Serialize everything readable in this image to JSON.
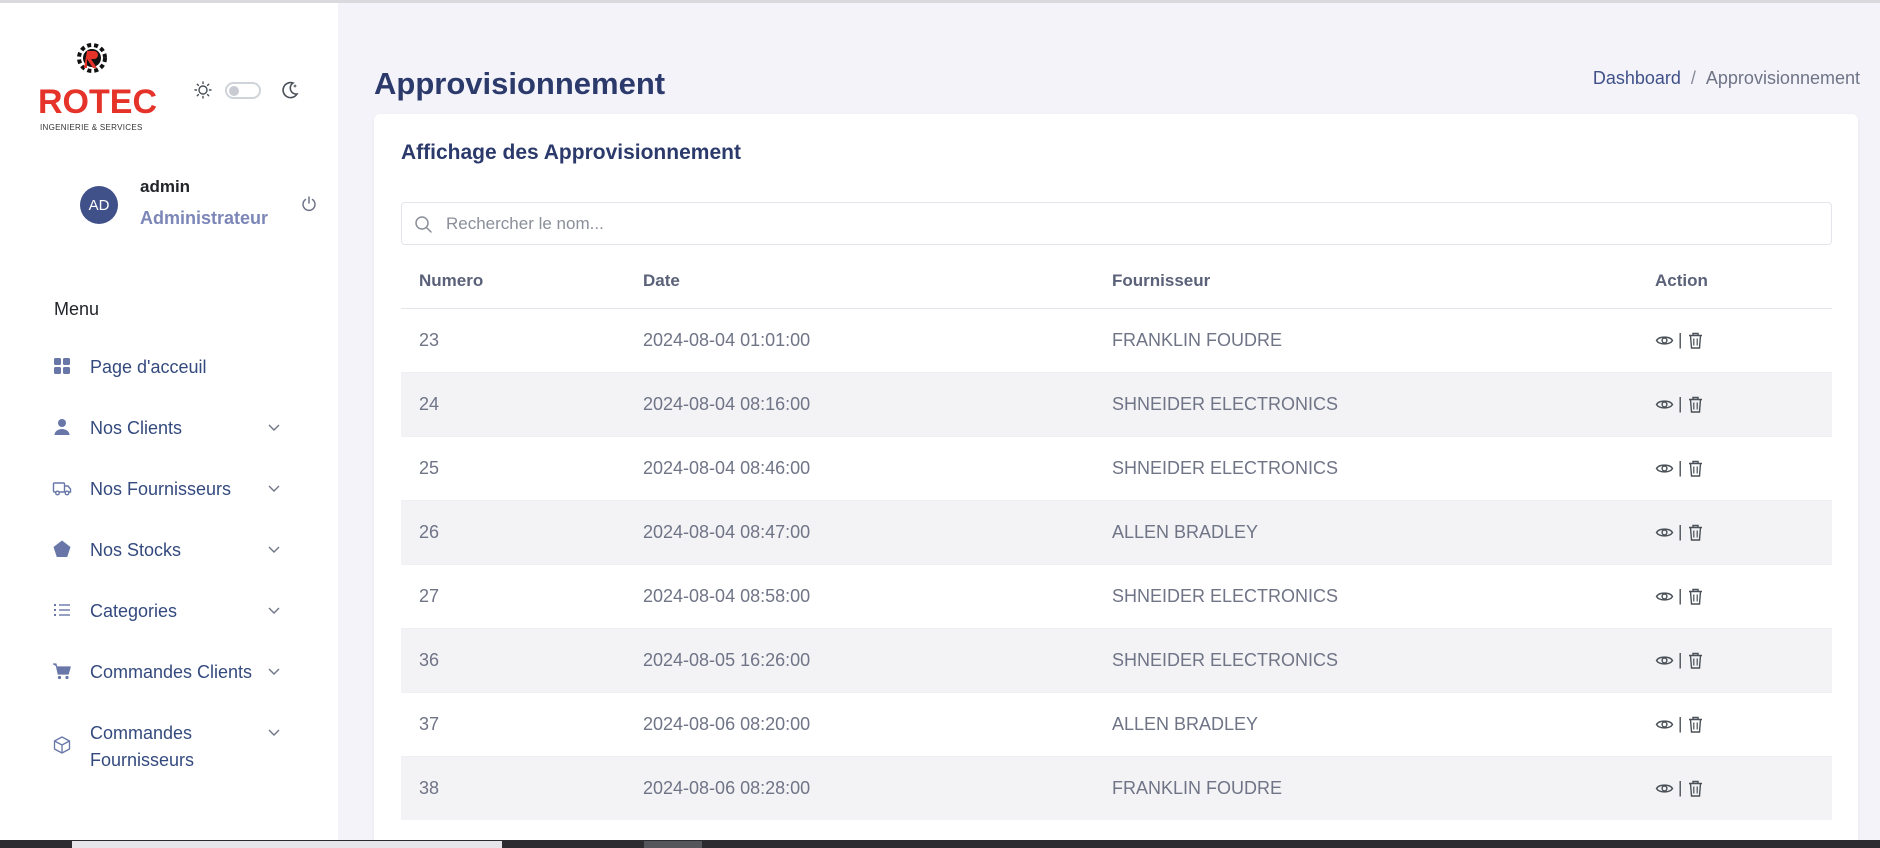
{
  "brand": {
    "name": "ROTEC",
    "tagline": "INGENIERIE & SERVICES"
  },
  "user": {
    "initials": "AD",
    "name": "admin",
    "role": "Administrateur"
  },
  "sidebar": {
    "menu_title": "Menu",
    "items": [
      {
        "label": "Page d'acceuil",
        "icon": "dashboard-grid-icon",
        "has_chevron": false
      },
      {
        "label": "Nos Clients",
        "icon": "user-icon",
        "has_chevron": true
      },
      {
        "label": "Nos Fournisseurs",
        "icon": "truck-icon",
        "has_chevron": true
      },
      {
        "label": "Nos Stocks",
        "icon": "pentagon-icon",
        "has_chevron": true
      },
      {
        "label": "Categories",
        "icon": "list-icon",
        "has_chevron": true
      },
      {
        "label": "Commandes Clients",
        "icon": "cart-icon",
        "has_chevron": true
      },
      {
        "label": "Commandes Fournisseurs",
        "icon": "box-icon",
        "has_chevron": true
      }
    ]
  },
  "header": {
    "title": "Approvisionnement",
    "breadcrumb": {
      "link": "Dashboard",
      "separator": "/",
      "current": "Approvisionnement"
    }
  },
  "card": {
    "title": "Affichage des Approvisionnement",
    "search_placeholder": "Rechercher le nom...",
    "search_value": ""
  },
  "table": {
    "columns": [
      "Numero",
      "Date",
      "Fournisseur",
      "Action"
    ],
    "rows": [
      {
        "numero": "23",
        "date": "2024-08-04 01:01:00",
        "fournisseur": "FRANKLIN FOUDRE"
      },
      {
        "numero": "24",
        "date": "2024-08-04 08:16:00",
        "fournisseur": "SHNEIDER ELECTRONICS"
      },
      {
        "numero": "25",
        "date": "2024-08-04 08:46:00",
        "fournisseur": "SHNEIDER ELECTRONICS"
      },
      {
        "numero": "26",
        "date": "2024-08-04 08:47:00",
        "fournisseur": "ALLEN BRADLEY"
      },
      {
        "numero": "27",
        "date": "2024-08-04 08:58:00",
        "fournisseur": "SHNEIDER ELECTRONICS"
      },
      {
        "numero": "36",
        "date": "2024-08-05 16:26:00",
        "fournisseur": "SHNEIDER ELECTRONICS"
      },
      {
        "numero": "37",
        "date": "2024-08-06 08:20:00",
        "fournisseur": "ALLEN BRADLEY"
      },
      {
        "numero": "38",
        "date": "2024-08-06 08:28:00",
        "fournisseur": "FRANKLIN FOUDRE"
      }
    ],
    "action_separator": "|"
  },
  "colors": {
    "primary": "#405189",
    "brand_red": "#e5332a",
    "nav_text": "#344a7e",
    "stripe": "#f3f3f5"
  }
}
